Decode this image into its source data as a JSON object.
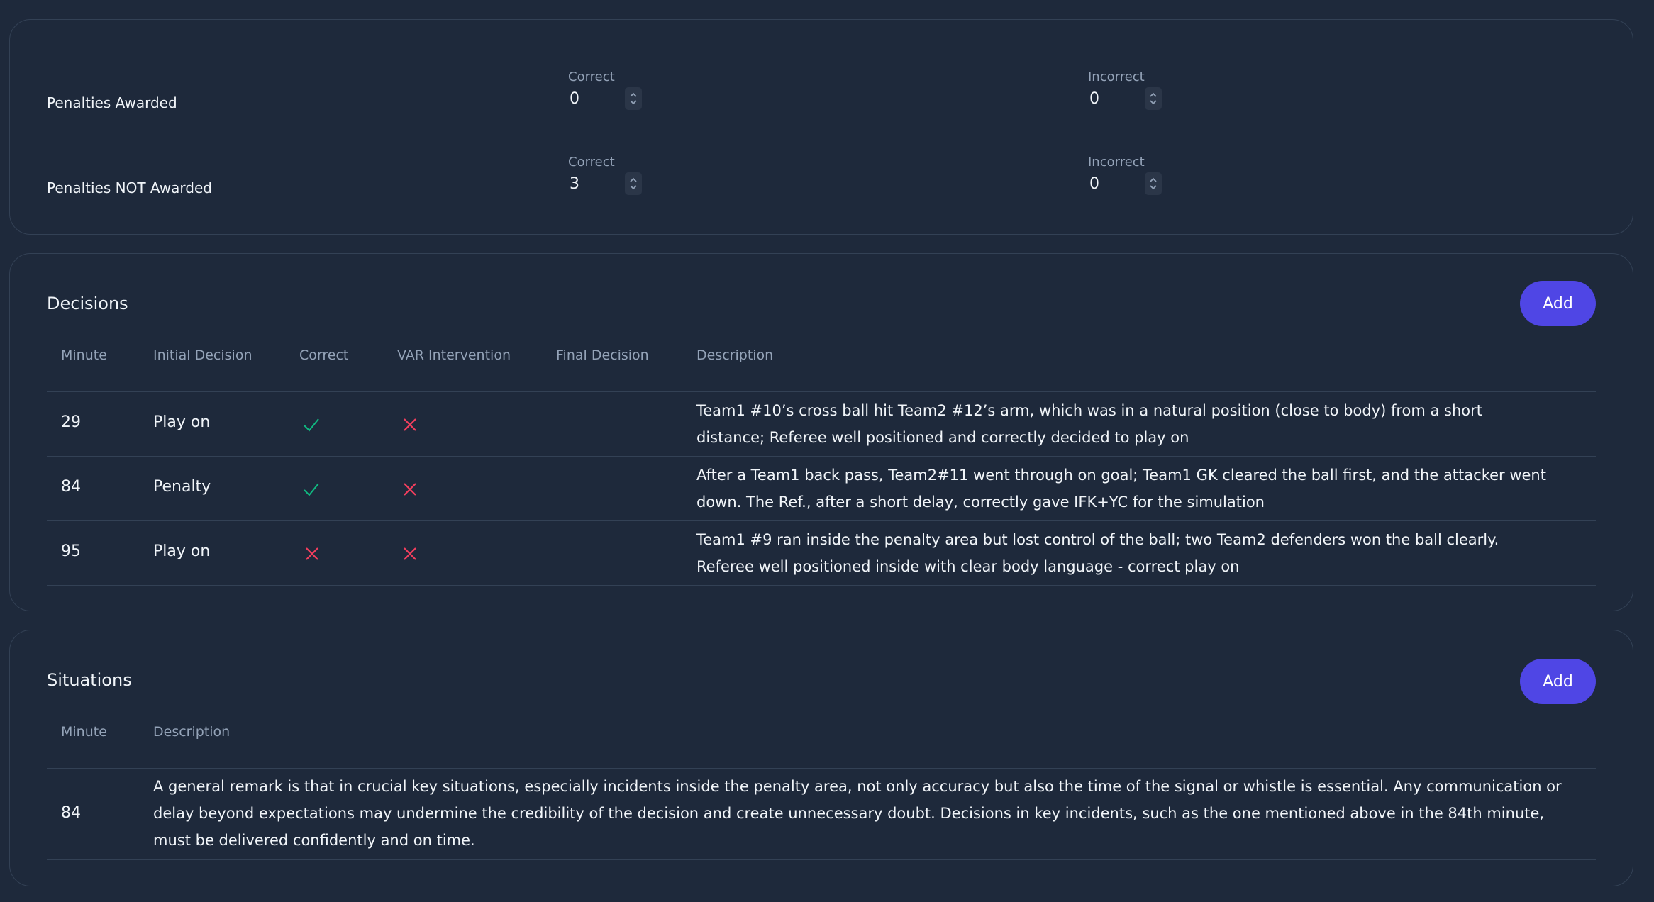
{
  "penalties": {
    "rows": [
      {
        "label": "Penalties Awarded",
        "correct_label": "Correct",
        "correct_value": "0",
        "incorrect_label": "Incorrect",
        "incorrect_value": "0"
      },
      {
        "label": "Penalties NOT Awarded",
        "correct_label": "Correct",
        "correct_value": "3",
        "incorrect_label": "Incorrect",
        "incorrect_value": "0"
      }
    ]
  },
  "decisions": {
    "title": "Decisions",
    "add_label": "Add",
    "columns": [
      "Minute",
      "Initial Decision",
      "Correct",
      "VAR Intervention",
      "Final Decision",
      "Description"
    ],
    "rows": [
      {
        "minute": "29",
        "initial": "Play on",
        "correct": "check",
        "var": "cross",
        "final": "",
        "description": "Team1 #10’s cross ball hit Team2 #12’s arm, which was in a natural position (close to body) from a short distance; Referee well positioned and correctly decided to play on"
      },
      {
        "minute": "84",
        "initial": "Penalty",
        "correct": "check",
        "var": "cross",
        "final": "",
        "description": "After a Team1 back pass, Team2#11 went through on goal; Team1 GK cleared the ball first, and the attacker went down. The Ref., after a short delay, correctly gave IFK+YC for the simulation"
      },
      {
        "minute": "95",
        "initial": "Play on",
        "correct": "cross",
        "var": "cross",
        "final": "",
        "description": "Team1 #9 ran inside the penalty area but lost control of the ball; two Team2 defenders won the ball clearly. Referee well positioned inside with clear body language - correct play on"
      }
    ]
  },
  "situations": {
    "title": "Situations",
    "add_label": "Add",
    "columns": [
      "Minute",
      "Description"
    ],
    "rows": [
      {
        "minute": "84",
        "description": "A general remark is that in crucial key situations, especially incidents inside the penalty area, not only accuracy but also the time of the signal or whistle is essential. Any communication or delay beyond expectations may undermine the credibility of the decision and create unnecessary doubt. Decisions in key incidents, such as the one mentioned above in the 84th minute, must be delivered confidently and on time."
      }
    ]
  },
  "colors": {
    "background": "#1e293b",
    "accent": "#4f46e5",
    "check": "#10b981",
    "cross": "#f43f5e"
  }
}
